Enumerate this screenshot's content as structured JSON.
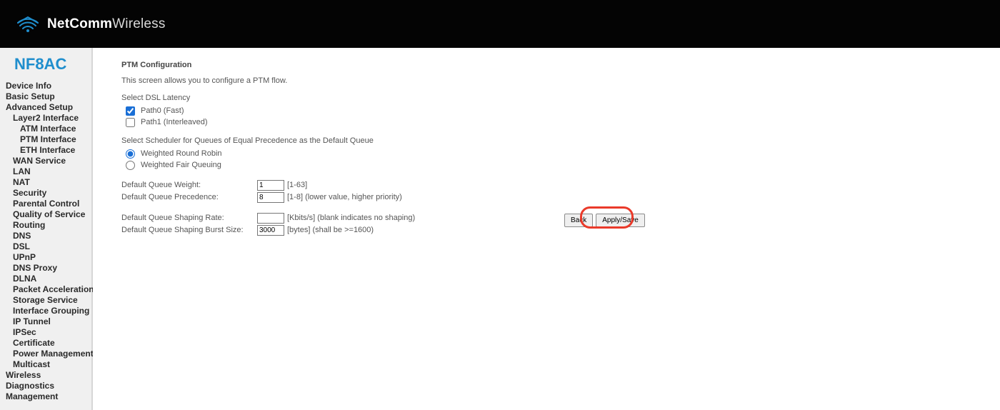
{
  "brand": {
    "bold": "NetComm",
    "light": "Wireless"
  },
  "model": "NF8AC",
  "nav": {
    "device_info": "Device Info",
    "basic_setup": "Basic Setup",
    "advanced_setup": "Advanced Setup",
    "layer2": "Layer2 Interface",
    "atm": "ATM Interface",
    "ptm": "PTM Interface",
    "eth": "ETH Interface",
    "wan_service": "WAN Service",
    "lan": "LAN",
    "nat": "NAT",
    "security": "Security",
    "parental": "Parental Control",
    "qos": "Quality of Service",
    "routing": "Routing",
    "dns": "DNS",
    "dsl": "DSL",
    "upnp": "UPnP",
    "dns_proxy": "DNS Proxy",
    "dlna": "DLNA",
    "packet_accel": "Packet Acceleration",
    "storage": "Storage Service",
    "if_group": "Interface Grouping",
    "ip_tunnel": "IP Tunnel",
    "ipsec": "IPSec",
    "certificate": "Certificate",
    "power": "Power Management",
    "multicast": "Multicast",
    "wireless": "Wireless",
    "diagnostics": "Diagnostics",
    "management": "Management"
  },
  "page": {
    "title": "PTM Configuration",
    "description": "This screen allows you to configure a PTM flow.",
    "latency_label": "Select DSL Latency",
    "path0_label": "Path0 (Fast)",
    "path1_label": "Path1 (Interleaved)",
    "scheduler_label": "Select Scheduler for Queues of Equal Precedence as the Default Queue",
    "wrr_label": "Weighted Round Robin",
    "wfq_label": "Weighted Fair Queuing",
    "weight_label": "Default Queue Weight:",
    "weight_value": "1",
    "weight_hint": "[1-63]",
    "precedence_label": "Default Queue Precedence:",
    "precedence_value": "8",
    "precedence_hint": "[1-8] (lower value, higher priority)",
    "shaping_rate_label": "Default Queue Shaping Rate:",
    "shaping_rate_value": "",
    "shaping_rate_hint": "[Kbits/s] (blank indicates no shaping)",
    "shaping_burst_label": "Default Queue Shaping Burst Size:",
    "shaping_burst_value": "3000",
    "shaping_burst_hint": "[bytes] (shall be >=1600)",
    "back_button": "Back",
    "apply_button": "Apply/Save"
  }
}
